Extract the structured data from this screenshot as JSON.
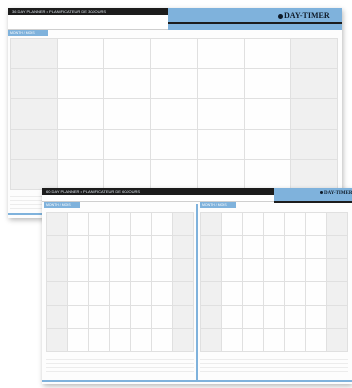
{
  "brand": {
    "logo": "DAY-TIMER"
  },
  "back_sheet": {
    "title": "36 DAY PLANNER • PLANIFICATEUR DE 30JOURS",
    "tab": "MONTH / MOIS"
  },
  "front_sheet": {
    "title": "60 DAY PLANNER • PLANIFICATEUR DE 60JOURS",
    "left_tab": "MONTH / MOIS",
    "right_tab": "MONTH / MOIS"
  },
  "colors": {
    "accent_blue": "#7fb2dc",
    "dark": "#1c1c1c",
    "shade": "#f0f0f0"
  },
  "icons": [
    "logo-dot-icon"
  ]
}
